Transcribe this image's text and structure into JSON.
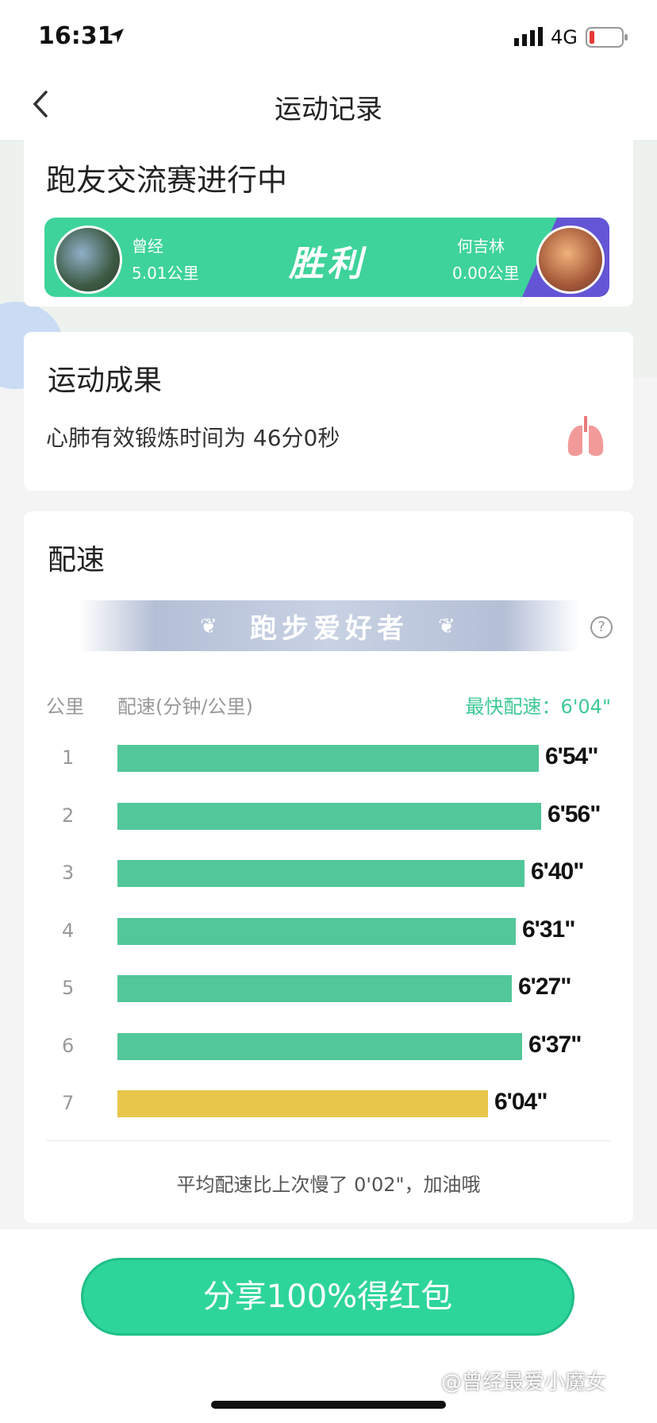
{
  "status_bar": {
    "time": "16:31",
    "network": "4G"
  },
  "nav": {
    "title": "运动记录"
  },
  "match": {
    "title": "跑友交流赛进行中",
    "result": "胜利",
    "player1": {
      "name": "曾经",
      "distance": "5.01公里"
    },
    "player2": {
      "name": "何吉林",
      "distance": "0.00公里"
    }
  },
  "result_card": {
    "title": "运动成果",
    "cardio_text": "心肺有效锻炼时间为 46分0秒"
  },
  "pace": {
    "title": "配速",
    "badge": "跑步爱好者",
    "col_km": "公里",
    "col_pace": "配速(分钟/公里)",
    "fastest": "最快配速：6'04\"",
    "rows": [
      {
        "km": "1",
        "pace": "6'54\"",
        "seconds": 414,
        "fastest": false
      },
      {
        "km": "2",
        "pace": "6'56\"",
        "seconds": 416,
        "fastest": false
      },
      {
        "km": "3",
        "pace": "6'40\"",
        "seconds": 400,
        "fastest": false
      },
      {
        "km": "4",
        "pace": "6'31\"",
        "seconds": 391,
        "fastest": false
      },
      {
        "km": "5",
        "pace": "6'27\"",
        "seconds": 387,
        "fastest": false
      },
      {
        "km": "6",
        "pace": "6'37\"",
        "seconds": 397,
        "fastest": false
      },
      {
        "km": "7",
        "pace": "6'04\"",
        "seconds": 364,
        "fastest": true
      }
    ],
    "compare_text": "平均配速比上次慢了 0'02\"，加油哦"
  },
  "share_button": "分享100%得红包",
  "watermark": "@曾经最爱小魔女",
  "colors": {
    "accent": "#2ed59a",
    "bar": "#52c79a",
    "fastest_bar": "#e8c64a",
    "opponent": "#6455d6"
  }
}
